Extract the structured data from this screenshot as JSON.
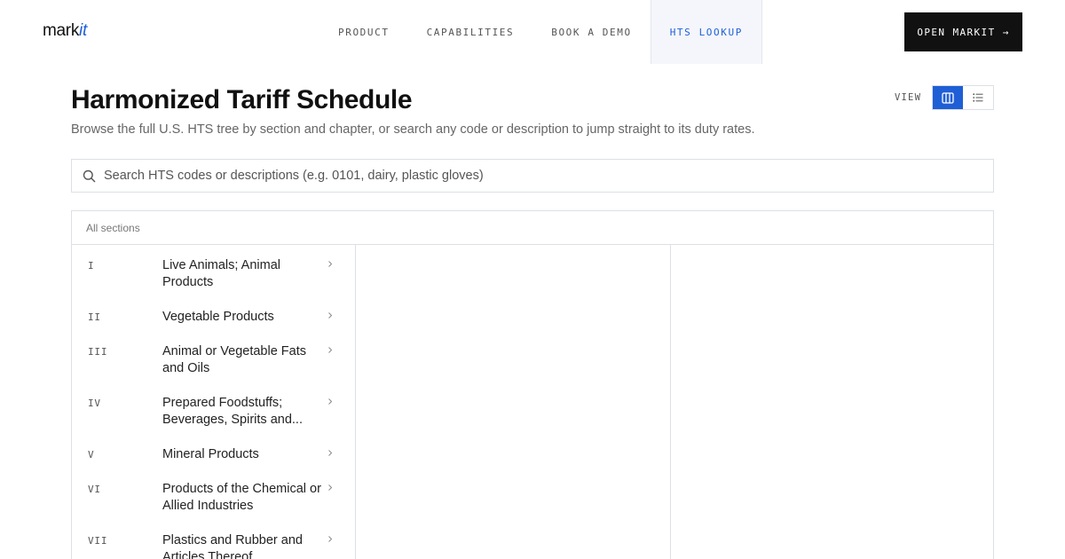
{
  "nav": {
    "logo_text": "mark",
    "logo_accent": "it",
    "links": [
      "PRODUCT",
      "CAPABILITIES",
      "BOOK A DEMO",
      "HTS LOOKUP"
    ],
    "active_link": "HTS LOOKUP",
    "cta_label": "OPEN MARKIT →"
  },
  "header": {
    "title": "Harmonized Tariff Schedule",
    "subtitle": "Browse the full U.S. HTS tree by section and chapter, or search any code or description to jump straight to its duty rates.",
    "view_label": "VIEW",
    "view_modes": [
      "columns-icon",
      "list-icon"
    ],
    "active_view": "columns-icon"
  },
  "search": {
    "placeholder": "Search HTS codes or descriptions (e.g. 0101, dairy, plastic gloves)",
    "value": ""
  },
  "browser": {
    "breadcrumb": "All sections",
    "sections": [
      {
        "num": "I",
        "title": "Live Animals; Animal Products"
      },
      {
        "num": "II",
        "title": "Vegetable Products"
      },
      {
        "num": "III",
        "title": "Animal or Vegetable Fats and Oils"
      },
      {
        "num": "IV",
        "title": "Prepared Foodstuffs; Beverages, Spirits and..."
      },
      {
        "num": "V",
        "title": "Mineral Products"
      },
      {
        "num": "VI",
        "title": "Products of the Chemical or Allied Industries"
      },
      {
        "num": "VII",
        "title": "Plastics and Rubber and Articles Thereof"
      }
    ]
  },
  "colors": {
    "accent": "#1f5fd6",
    "dark": "#111111",
    "border": "#dcdfe5"
  }
}
